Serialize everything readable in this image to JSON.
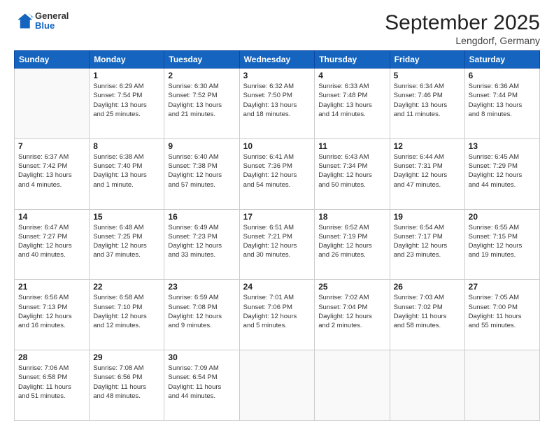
{
  "header": {
    "logo_general": "General",
    "logo_blue": "Blue",
    "main_title": "September 2025",
    "subtitle": "Lengdorf, Germany"
  },
  "days_of_week": [
    "Sunday",
    "Monday",
    "Tuesday",
    "Wednesday",
    "Thursday",
    "Friday",
    "Saturday"
  ],
  "weeks": [
    [
      {
        "day": "",
        "info": ""
      },
      {
        "day": "1",
        "info": "Sunrise: 6:29 AM\nSunset: 7:54 PM\nDaylight: 13 hours\nand 25 minutes."
      },
      {
        "day": "2",
        "info": "Sunrise: 6:30 AM\nSunset: 7:52 PM\nDaylight: 13 hours\nand 21 minutes."
      },
      {
        "day": "3",
        "info": "Sunrise: 6:32 AM\nSunset: 7:50 PM\nDaylight: 13 hours\nand 18 minutes."
      },
      {
        "day": "4",
        "info": "Sunrise: 6:33 AM\nSunset: 7:48 PM\nDaylight: 13 hours\nand 14 minutes."
      },
      {
        "day": "5",
        "info": "Sunrise: 6:34 AM\nSunset: 7:46 PM\nDaylight: 13 hours\nand 11 minutes."
      },
      {
        "day": "6",
        "info": "Sunrise: 6:36 AM\nSunset: 7:44 PM\nDaylight: 13 hours\nand 8 minutes."
      }
    ],
    [
      {
        "day": "7",
        "info": "Sunrise: 6:37 AM\nSunset: 7:42 PM\nDaylight: 13 hours\nand 4 minutes."
      },
      {
        "day": "8",
        "info": "Sunrise: 6:38 AM\nSunset: 7:40 PM\nDaylight: 13 hours\nand 1 minute."
      },
      {
        "day": "9",
        "info": "Sunrise: 6:40 AM\nSunset: 7:38 PM\nDaylight: 12 hours\nand 57 minutes."
      },
      {
        "day": "10",
        "info": "Sunrise: 6:41 AM\nSunset: 7:36 PM\nDaylight: 12 hours\nand 54 minutes."
      },
      {
        "day": "11",
        "info": "Sunrise: 6:43 AM\nSunset: 7:34 PM\nDaylight: 12 hours\nand 50 minutes."
      },
      {
        "day": "12",
        "info": "Sunrise: 6:44 AM\nSunset: 7:31 PM\nDaylight: 12 hours\nand 47 minutes."
      },
      {
        "day": "13",
        "info": "Sunrise: 6:45 AM\nSunset: 7:29 PM\nDaylight: 12 hours\nand 44 minutes."
      }
    ],
    [
      {
        "day": "14",
        "info": "Sunrise: 6:47 AM\nSunset: 7:27 PM\nDaylight: 12 hours\nand 40 minutes."
      },
      {
        "day": "15",
        "info": "Sunrise: 6:48 AM\nSunset: 7:25 PM\nDaylight: 12 hours\nand 37 minutes."
      },
      {
        "day": "16",
        "info": "Sunrise: 6:49 AM\nSunset: 7:23 PM\nDaylight: 12 hours\nand 33 minutes."
      },
      {
        "day": "17",
        "info": "Sunrise: 6:51 AM\nSunset: 7:21 PM\nDaylight: 12 hours\nand 30 minutes."
      },
      {
        "day": "18",
        "info": "Sunrise: 6:52 AM\nSunset: 7:19 PM\nDaylight: 12 hours\nand 26 minutes."
      },
      {
        "day": "19",
        "info": "Sunrise: 6:54 AM\nSunset: 7:17 PM\nDaylight: 12 hours\nand 23 minutes."
      },
      {
        "day": "20",
        "info": "Sunrise: 6:55 AM\nSunset: 7:15 PM\nDaylight: 12 hours\nand 19 minutes."
      }
    ],
    [
      {
        "day": "21",
        "info": "Sunrise: 6:56 AM\nSunset: 7:13 PM\nDaylight: 12 hours\nand 16 minutes."
      },
      {
        "day": "22",
        "info": "Sunrise: 6:58 AM\nSunset: 7:10 PM\nDaylight: 12 hours\nand 12 minutes."
      },
      {
        "day": "23",
        "info": "Sunrise: 6:59 AM\nSunset: 7:08 PM\nDaylight: 12 hours\nand 9 minutes."
      },
      {
        "day": "24",
        "info": "Sunrise: 7:01 AM\nSunset: 7:06 PM\nDaylight: 12 hours\nand 5 minutes."
      },
      {
        "day": "25",
        "info": "Sunrise: 7:02 AM\nSunset: 7:04 PM\nDaylight: 12 hours\nand 2 minutes."
      },
      {
        "day": "26",
        "info": "Sunrise: 7:03 AM\nSunset: 7:02 PM\nDaylight: 11 hours\nand 58 minutes."
      },
      {
        "day": "27",
        "info": "Sunrise: 7:05 AM\nSunset: 7:00 PM\nDaylight: 11 hours\nand 55 minutes."
      }
    ],
    [
      {
        "day": "28",
        "info": "Sunrise: 7:06 AM\nSunset: 6:58 PM\nDaylight: 11 hours\nand 51 minutes."
      },
      {
        "day": "29",
        "info": "Sunrise: 7:08 AM\nSunset: 6:56 PM\nDaylight: 11 hours\nand 48 minutes."
      },
      {
        "day": "30",
        "info": "Sunrise: 7:09 AM\nSunset: 6:54 PM\nDaylight: 11 hours\nand 44 minutes."
      },
      {
        "day": "",
        "info": ""
      },
      {
        "day": "",
        "info": ""
      },
      {
        "day": "",
        "info": ""
      },
      {
        "day": "",
        "info": ""
      }
    ]
  ]
}
